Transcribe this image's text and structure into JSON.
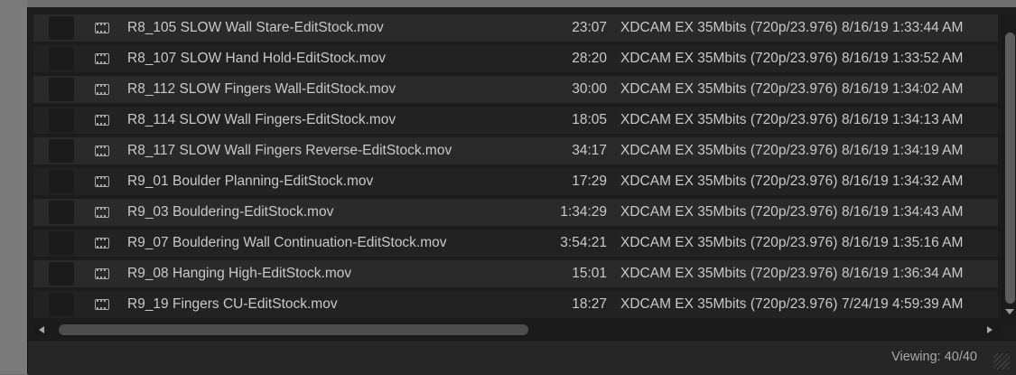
{
  "rows": [
    {
      "name": "R8_105 SLOW Wall Stare-EditStock.mov",
      "duration": "23:07",
      "format": "XDCAM EX 35Mbits (720p/23.976)",
      "date": "8/16/19 1:33:44 AM"
    },
    {
      "name": "R8_107 SLOW Hand Hold-EditStock.mov",
      "duration": "28:20",
      "format": "XDCAM EX 35Mbits (720p/23.976)",
      "date": "8/16/19 1:33:52 AM"
    },
    {
      "name": "R8_112 SLOW Fingers Wall-EditStock.mov",
      "duration": "30:00",
      "format": "XDCAM EX 35Mbits (720p/23.976)",
      "date": "8/16/19 1:34:02 AM"
    },
    {
      "name": "R8_114 SLOW Wall Fingers-EditStock.mov",
      "duration": "18:05",
      "format": "XDCAM EX 35Mbits (720p/23.976)",
      "date": "8/16/19 1:34:13 AM"
    },
    {
      "name": "R8_117 SLOW Wall Fingers Reverse-EditStock.mov",
      "duration": "34:17",
      "format": "XDCAM EX 35Mbits (720p/23.976)",
      "date": "8/16/19 1:34:19 AM"
    },
    {
      "name": "R9_01 Boulder Planning-EditStock.mov",
      "duration": "17:29",
      "format": "XDCAM EX 35Mbits (720p/23.976)",
      "date": "8/16/19 1:34:32 AM"
    },
    {
      "name": "R9_03 Bouldering-EditStock.mov",
      "duration": "1:34:29",
      "format": "XDCAM EX 35Mbits (720p/23.976)",
      "date": "8/16/19 1:34:43 AM"
    },
    {
      "name": "R9_07 Bouldering Wall Continuation-EditStock.mov",
      "duration": "3:54:21",
      "format": "XDCAM EX 35Mbits (720p/23.976)",
      "date": "8/16/19 1:35:16 AM"
    },
    {
      "name": "R9_08 Hanging High-EditStock.mov",
      "duration": "15:01",
      "format": "XDCAM EX 35Mbits (720p/23.976)",
      "date": "8/16/19 1:36:34 AM"
    },
    {
      "name": "R9_19 Fingers CU-EditStock.mov",
      "duration": "18:27",
      "format": "XDCAM EX 35Mbits (720p/23.976)",
      "date": "7/24/19 4:59:39 AM"
    }
  ],
  "status": {
    "viewing": "Viewing: 40/40"
  },
  "icons": {
    "clip": "film-clip-icon"
  },
  "colors": {
    "panel_bg": "#1c1c1d",
    "row_odd": "#2a2a2b",
    "row_even": "#222223",
    "text": "#c9c9c9"
  }
}
